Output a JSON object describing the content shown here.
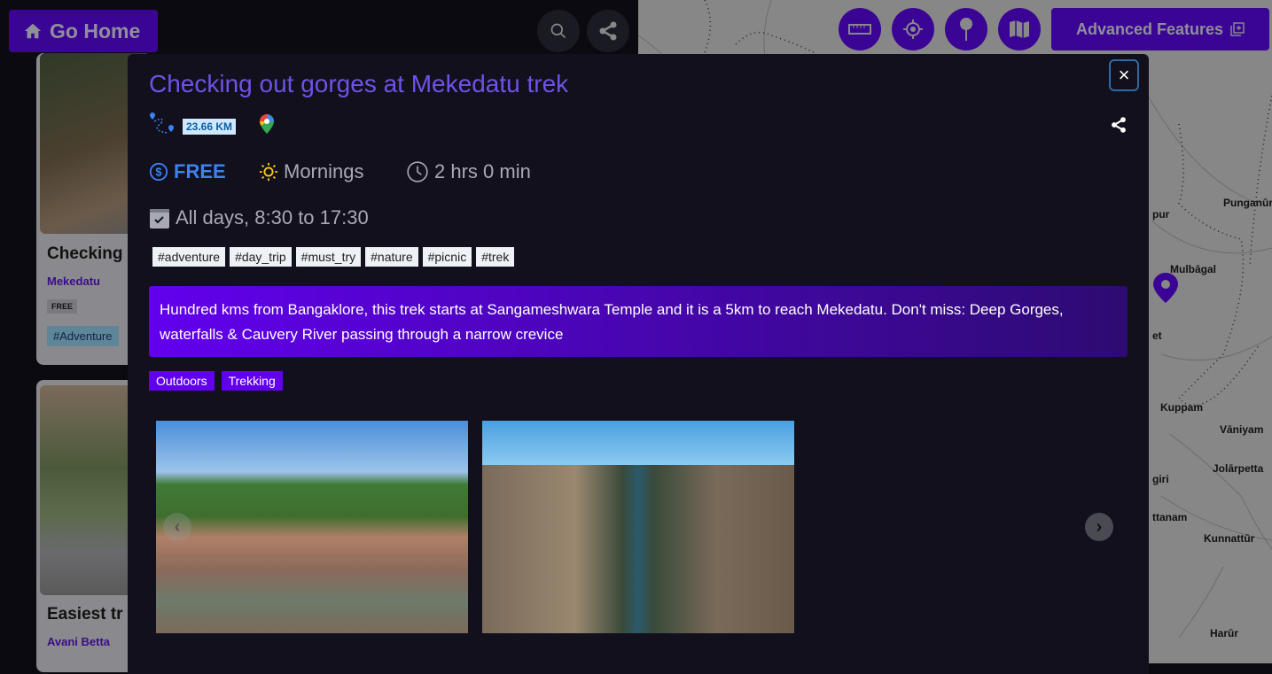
{
  "header": {
    "go_home_label": "Go Home",
    "advanced_features_label": "Advanced Features"
  },
  "map": {
    "towns": [
      "Punganūr",
      "pur",
      "Mulbāgal",
      "et",
      "Kuppam",
      "Vāniyam",
      "Jolārpetta",
      "giri",
      "ttanam",
      "Kunnattūr",
      "Harūr"
    ],
    "marker_color": "#3a0594"
  },
  "background_cards": [
    {
      "title": "Checking",
      "location": "Mekedatu",
      "price": "FREE",
      "tag": "#Adventure"
    },
    {
      "title": "Easiest tr",
      "location": "Avani Betta"
    }
  ],
  "modal": {
    "title": "Checking out gorges at Mekedatu trek",
    "distance": "23.66 KM",
    "price": "FREE",
    "time_of_day": "Mornings",
    "duration": "2 hrs 0 min",
    "schedule": "All days, 8:30 to 17:30",
    "hashtags": [
      "#adventure",
      "#day_trip",
      "#must_try",
      "#nature",
      "#picnic",
      "#trek"
    ],
    "description": "Hundred kms from Bangaklore, this trek starts at Sangameshwara Temple and it is a 5km to reach Mekedatu. Don't miss: Deep Gorges, waterfalls & Cauvery River passing through a narrow crevice",
    "categories": [
      "Outdoors",
      "Trekking"
    ],
    "close_label": "×",
    "colors": {
      "title": "#6f52e8",
      "accent": "#6200ee",
      "price": "#3b82f6"
    }
  }
}
